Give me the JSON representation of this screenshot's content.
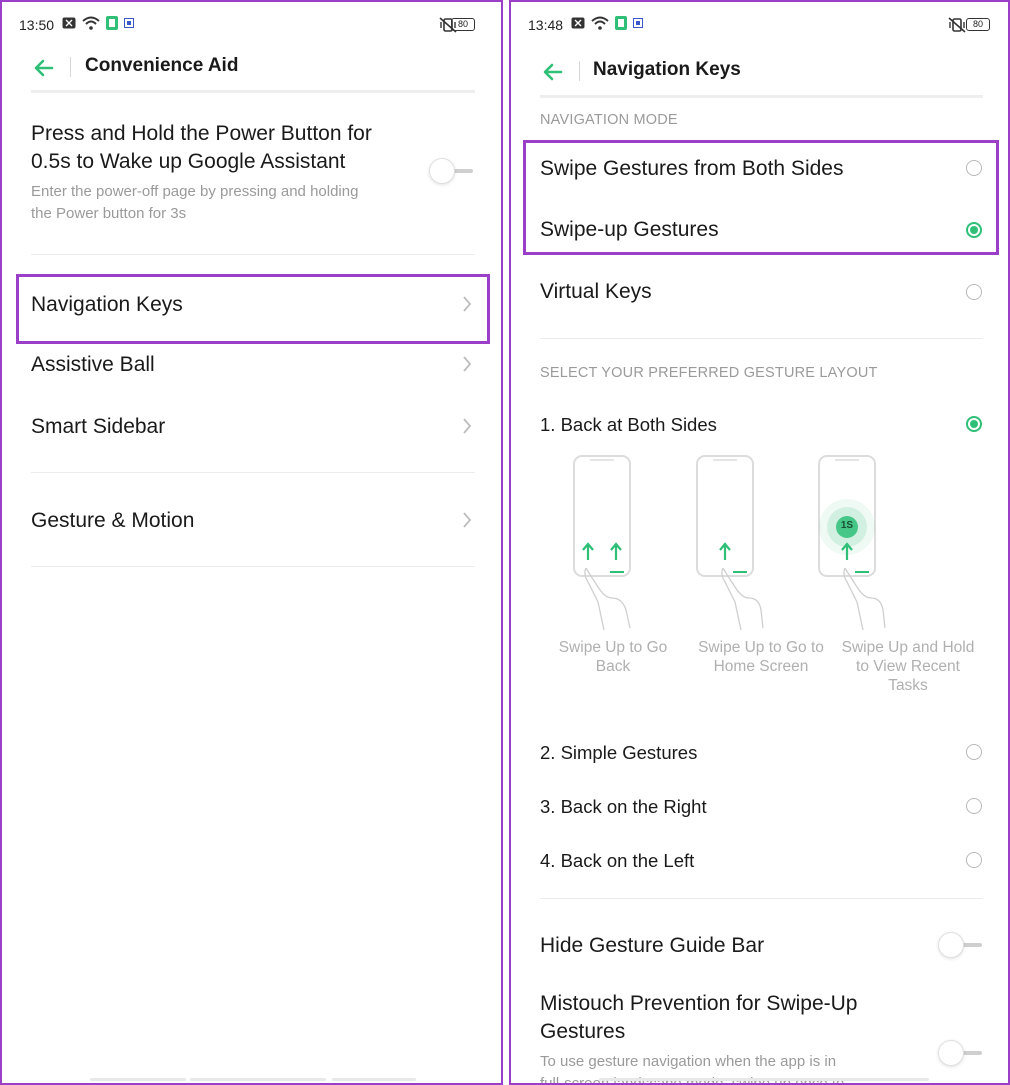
{
  "left": {
    "status": {
      "time": "13:50",
      "battery": "80"
    },
    "header": {
      "title": "Convenience Aid"
    },
    "power": {
      "title_line1": "Press and Hold the Power Button for",
      "title_line2": "0.5s to Wake up Google Assistant",
      "desc_line1": "Enter the power-off page by pressing and holding",
      "desc_line2": "the Power button for 3s",
      "enabled": false
    },
    "items": [
      {
        "label": "Navigation Keys"
      },
      {
        "label": "Assistive Ball"
      },
      {
        "label": "Smart Sidebar"
      },
      {
        "label": "Gesture & Motion"
      }
    ]
  },
  "right": {
    "status": {
      "time": "13:48",
      "battery": "80"
    },
    "header": {
      "title": "Navigation Keys"
    },
    "nav_mode_heading": "NAVIGATION MODE",
    "nav_modes": [
      {
        "label": "Swipe Gestures from Both Sides",
        "selected": false
      },
      {
        "label": "Swipe-up Gestures",
        "selected": true
      },
      {
        "label": "Virtual Keys",
        "selected": false
      }
    ],
    "layout_heading": "SELECT YOUR PREFERRED GESTURE LAYOUT",
    "layouts": [
      {
        "label": "1. Back at Both Sides",
        "selected": true
      },
      {
        "label": "2. Simple Gestures",
        "selected": false
      },
      {
        "label": "3. Back on the Right",
        "selected": false
      },
      {
        "label": "4. Back on the Left",
        "selected": false
      }
    ],
    "illustration": {
      "hold_badge": "1S",
      "captions": [
        {
          "line1": "Swipe Up to Go",
          "line2": "Back",
          "line3": ""
        },
        {
          "line1": "Swipe Up to Go to",
          "line2": "Home Screen",
          "line3": ""
        },
        {
          "line1": "Swipe Up and Hold",
          "line2": "to View Recent",
          "line3": "Tasks"
        }
      ]
    },
    "hide_bar": {
      "label": "Hide Gesture Guide Bar",
      "enabled": false
    },
    "mistouch": {
      "title_line1": "Mistouch Prevention for Swipe-Up",
      "title_line2": "Gestures",
      "desc_line1": "To use gesture navigation when the app is in",
      "desc_line2": "full-screen landscape mode, swipe up once to",
      "enabled": false
    }
  },
  "colors": {
    "accent": "#2fbf77",
    "highlight": "#9b3fc8",
    "muted": "#9a9a9a"
  }
}
